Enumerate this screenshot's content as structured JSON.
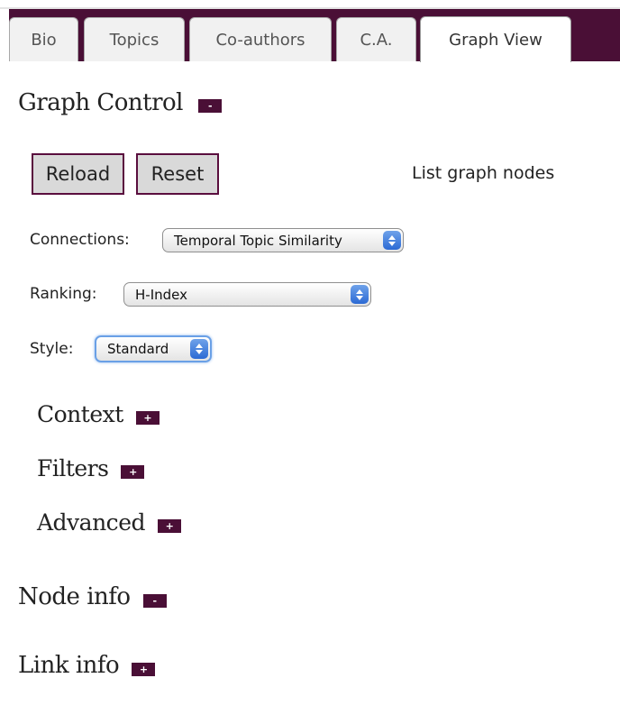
{
  "tabs": [
    {
      "label": "Bio"
    },
    {
      "label": "Topics"
    },
    {
      "label": "Co-authors"
    },
    {
      "label": "C.A."
    },
    {
      "label": "Graph View",
      "active": true
    }
  ],
  "graph_control": {
    "title": "Graph Control",
    "toggle": "-",
    "reload_label": "Reload",
    "reset_label": "Reset",
    "list_nodes_label": "List graph nodes"
  },
  "connections": {
    "label": "Connections:",
    "value": "Temporal Topic Similarity"
  },
  "ranking": {
    "label": "Ranking:",
    "value": "H-Index"
  },
  "style": {
    "label": "Style:",
    "value": "Standard"
  },
  "sections": {
    "context": {
      "title": "Context",
      "toggle": "+"
    },
    "filters": {
      "title": "Filters",
      "toggle": "+"
    },
    "advanced": {
      "title": "Advanced",
      "toggle": "+"
    },
    "node_info": {
      "title": "Node info",
      "toggle": "-"
    },
    "link_info": {
      "title": "Link info",
      "toggle": "+"
    }
  },
  "colors": {
    "accent": "#4a0f36",
    "select_arrow": "#2c6ad4",
    "focus_ring": "#6aa0e6"
  }
}
